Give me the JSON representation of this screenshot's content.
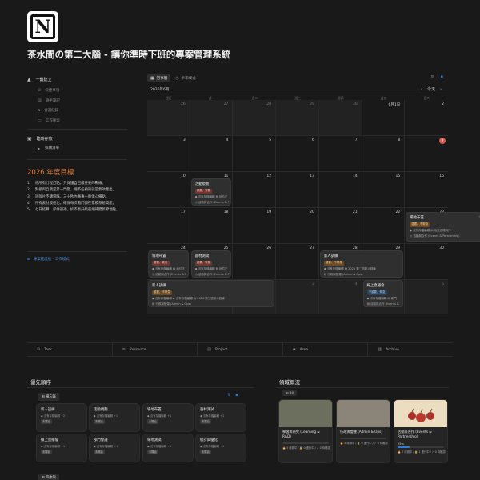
{
  "page": {
    "logo_letter": "N",
    "title": "茶水間の第二大腦 - 讓你準時下班的專案管理系統"
  },
  "quick": {
    "heading": "一鍵建立",
    "items": [
      {
        "icon": "check-icon",
        "label": "快捷事項"
      },
      {
        "icon": "note-icon",
        "label": "隨手筆記"
      },
      {
        "icon": "meeting-icon",
        "label": "會議紀錄"
      },
      {
        "icon": "doc-icon",
        "label": "工作專案"
      }
    ]
  },
  "temp": {
    "heading": "臨時存放",
    "item": "採購清單"
  },
  "goals": {
    "title": "2026 年度目標",
    "items": [
      {
        "n": "1.",
        "text": "把所有行程打點，只保護自己最重要的戰線。"
      },
      {
        "n": "2.",
        "text": "對接與自我是第一門戲，絕不任被耗就是無效產出。"
      },
      {
        "n": "3.",
        "text": "短款片不講冒昧，三十秒內事事一應俱心備點。"
      },
      {
        "n": "4.",
        "text": "所有素材模組化，確保每次戰鬥都在累積系統資產。"
      },
      {
        "n": "5.",
        "text": "七日結算，部件調適，拆不斷升級前規律變新節地點。"
      }
    ],
    "board_link": "專案進度板 - 工作模式"
  },
  "calendar": {
    "tabs": [
      {
        "icon": "calendar-icon",
        "label": "行事曆",
        "active": true
      },
      {
        "icon": "clock-icon",
        "label": "卡車模式",
        "active": false
      }
    ],
    "month": "2026年6月",
    "today_label": "今天",
    "weekdays": [
      "週日",
      "週一",
      "週二",
      "週三",
      "週四",
      "週五",
      "週六"
    ],
    "days": [
      {
        "d": "26",
        "dim": true
      },
      {
        "d": "27",
        "dim": true
      },
      {
        "d": "28",
        "dim": true
      },
      {
        "d": "29",
        "dim": true
      },
      {
        "d": "30",
        "dim": true
      },
      {
        "d": "6月1日",
        "dim": false
      },
      {
        "d": "2",
        "dim": false
      },
      {
        "d": "3",
        "dim": false
      },
      {
        "d": "4",
        "dim": false
      },
      {
        "d": "5",
        "dim": false
      },
      {
        "d": "6",
        "dim": false
      },
      {
        "d": "7",
        "dim": false
      },
      {
        "d": "8",
        "dim": false
      },
      {
        "d": "9",
        "dim": false,
        "today": true
      },
      {
        "d": "10",
        "dim": false
      },
      {
        "d": "11",
        "dim": false
      },
      {
        "d": "12",
        "dim": false
      },
      {
        "d": "13",
        "dim": false
      },
      {
        "d": "14",
        "dim": false
      },
      {
        "d": "15",
        "dim": false
      },
      {
        "d": "16",
        "dim": false
      },
      {
        "d": "17",
        "dim": false
      },
      {
        "d": "18",
        "dim": false
      },
      {
        "d": "19",
        "dim": false
      },
      {
        "d": "20",
        "dim": false
      },
      {
        "d": "21",
        "dim": false
      },
      {
        "d": "22",
        "dim": false
      },
      {
        "d": "23",
        "dim": false
      },
      {
        "d": "24",
        "dim": false
      },
      {
        "d": "25",
        "dim": false
      },
      {
        "d": "26",
        "dim": false
      },
      {
        "d": "27",
        "dim": false
      },
      {
        "d": "28",
        "dim": false
      },
      {
        "d": "29",
        "dim": false
      },
      {
        "d": "30",
        "dim": false
      },
      {
        "d": "31",
        "dim": true
      },
      {
        "d": "7月1日",
        "dim": true
      },
      {
        "d": "2",
        "dim": true
      },
      {
        "d": "3",
        "dim": true
      },
      {
        "d": "4",
        "dim": true
      },
      {
        "d": "5",
        "dim": true
      },
      {
        "d": "6",
        "dim": true
      }
    ],
    "events": [
      {
        "title": "活動規劃",
        "tags": [
          {
            "text": "重要、緊急",
            "c": "red"
          }
        ],
        "props": [
          "◆ 沒有存檔編輯  ▤ 地位正",
          "◎ 活動與合作 (Events & P"
        ]
      },
      {
        "title": "場地布置",
        "tags": [
          {
            "text": "重要、不緊急",
            "c": "orange"
          }
        ],
        "props": [
          "◆ 沒有存檔編輯  ▤ 地位正確時作",
          "◎ 活動與合作 (Events & Partnership)"
        ],
        "more": "+1 ▾"
      },
      {
        "title": "場地布置",
        "tags": [
          {
            "text": "重要、緊急",
            "c": "red"
          }
        ],
        "props": [
          "◆ 沒有存檔編輯  ▤ 地位正",
          "◎ 活動與合作 (Events & P"
        ]
      },
      {
        "title": "器材測試",
        "tags": [
          {
            "text": "重要、緊急",
            "c": "red"
          }
        ],
        "props": [
          "◆ 沒有存檔編輯  ▤ 地位正",
          "◎ 活動與合作 (Events & P"
        ]
      },
      {
        "title": "新人訓練",
        "tags": [
          {
            "text": "重要、不緊急",
            "c": "orange"
          }
        ],
        "props": [
          "◆ 沒有存檔編輯  ▤ 2026 第二週新人訓練",
          "▤ 行政與營運 (Admin & Ops)"
        ]
      },
      {
        "title": "新人訓練",
        "tags": [
          {
            "text": "重要、不緊急",
            "c": "orange"
          }
        ],
        "props": [
          "◆ 沒有存檔編輯  ◆ 沒有存檔編輯  ▤ 2026 第二週新人訓練",
          "▤ 行政與營運 (Admin & Ops)"
        ]
      },
      {
        "title": "線上直播會",
        "tags": [
          {
            "text": "不重要、緊急",
            "c": "blue"
          }
        ],
        "props": [
          "◆ 沒有存檔編輯  ▤ 新門",
          "▤ 活動與合作 (Events &"
        ]
      }
    ]
  },
  "databases": [
    {
      "icon": "task-icon",
      "label": "Task"
    },
    {
      "icon": "resource-icon",
      "label": "Resource"
    },
    {
      "icon": "project-icon",
      "label": "Project"
    },
    {
      "icon": "area-icon",
      "label": "Area"
    },
    {
      "icon": "archive-icon",
      "label": "Archive"
    }
  ],
  "priority": {
    "title": "優先順序",
    "tab": "備忘錄",
    "tab2": "四象限",
    "cards": [
      {
        "title": "新人訓練",
        "prop": "◆ 沒有存檔編輯 +2",
        "badge": "未開始"
      },
      {
        "title": "活動規劃",
        "prop": "◆ 沒有存檔編輯 +1",
        "badge": "未開始"
      },
      {
        "title": "場地布置",
        "prop": "◆ 沒有存檔編輯 +1",
        "badge": "未開始"
      },
      {
        "title": "器材測試",
        "prop": "◆ 沒有存檔編輯 +1",
        "badge": "未開始"
      },
      {
        "title": "線上直播會",
        "prop": "◆ 沒有存檔編輯 +1",
        "badge": "未開始"
      },
      {
        "title": "部門會議",
        "prop": "◆ 沒有存檔編輯 +1",
        "badge": "未開始"
      },
      {
        "title": "場地測試",
        "prop": "◆ 沒有存檔編輯 +1",
        "badge": "未開始"
      },
      {
        "title": "統計與優化",
        "prop": "◆ 沒有存檔編輯 +1",
        "badge": "未開始"
      }
    ]
  },
  "area": {
    "title": "領域概況",
    "all_label": "All",
    "cards": [
      {
        "title": "學習與研究 (Learning & R&D)",
        "pct": "",
        "progress": 0,
        "stats": "🔥 3 待辦中  / 🔒 0 進行中  / ✓ 0 待確認",
        "img": "#6c6e5e"
      },
      {
        "title": "行政與營運 (Admin & Ops)",
        "pct": "",
        "progress": 0,
        "stats": "🔥 4 待辦中  / 🔒 0 進行中  / ✓ 0 待確認",
        "img": "#8a8578"
      },
      {
        "title": "活動與合作 (Events & Partnership)",
        "pct": "25%",
        "progress": 0.25,
        "stats": "🔥 7 待辦中  / 🔒 1 進行中  / ✓ 0 待確認",
        "img": "#ecdcc0"
      }
    ]
  }
}
